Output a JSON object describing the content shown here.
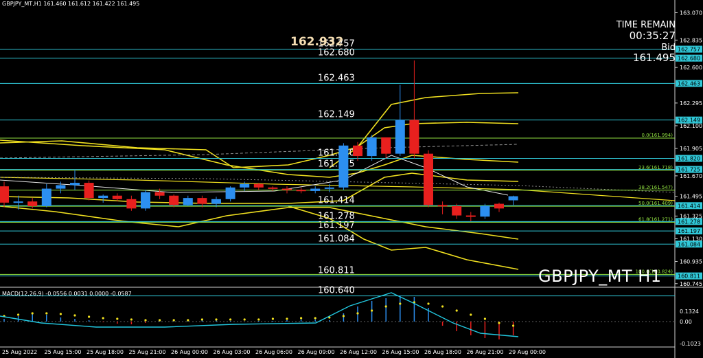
{
  "header": {
    "title": "GBPJPY_MT,H1  161.460 161.612 161.422 161.495"
  },
  "info": {
    "time_remain_label": "TIME REMAIN",
    "time_remain": "00:35:27",
    "bid_label": "Bid",
    "bid_value": "161.495"
  },
  "symbol_label": "GBPJPY_MT H1",
  "high_marker": "162.932",
  "macd": {
    "title": "MACD(12,26,9) -0.0556 0.0031 0.0000 -0.0587",
    "axis_labels": [
      "0.1324",
      "0.00",
      "-0.1023"
    ]
  },
  "price_axis": [
    "163.070",
    "162.835",
    "162.600",
    "162.295",
    "162.100",
    "161.905",
    "161.670",
    "161.495",
    "161.325",
    "161.130",
    "160.935",
    "160.745"
  ],
  "levels": [
    {
      "price": 162.757,
      "label": "162.757",
      "tag": "162.757"
    },
    {
      "price": 162.68,
      "label": "162.680",
      "tag": "162.680"
    },
    {
      "price": 162.463,
      "label": "162.463",
      "tag": "162.463"
    },
    {
      "price": 162.149,
      "label": "162.149",
      "tag": "162.149"
    },
    {
      "price": 161.82,
      "label": "161.820",
      "tag": "161.820"
    },
    {
      "price": 161.725,
      "label": "161.725",
      "tag": "161.725"
    },
    {
      "price": 161.414,
      "label": "161.414",
      "tag": "161.414"
    },
    {
      "price": 161.278,
      "label": "161.278",
      "tag": "161.278"
    },
    {
      "price": 161.197,
      "label": "161.197",
      "tag": "161.197"
    },
    {
      "price": 161.084,
      "label": "161.084",
      "tag": "161.084"
    },
    {
      "price": 160.811,
      "label": "160.811",
      "tag": "160.811"
    },
    {
      "price": 160.64,
      "label": "160.640",
      "tag": ""
    }
  ],
  "fib": [
    {
      "price": 161.994,
      "label": "0.0(161.994)"
    },
    {
      "price": 161.718,
      "label": "23.6(161.718)"
    },
    {
      "price": 161.547,
      "label": "38.2(161.547)"
    },
    {
      "price": 161.409,
      "label": "50.0(161.409)"
    },
    {
      "price": 161.271,
      "label": "61.8(161.271)"
    },
    {
      "price": 160.824,
      "label": "100.0(160.824)"
    }
  ],
  "time_axis": [
    "25 Aug 2022",
    "25 Aug 15:00",
    "25 Aug 18:00",
    "25 Aug 21:00",
    "26 Aug 00:00",
    "26 Aug 03:00",
    "26 Aug 06:00",
    "26 Aug 09:00",
    "26 Aug 12:00",
    "26 Aug 15:00",
    "26 Aug 18:00",
    "26 Aug 21:00",
    "29 Aug 00:00"
  ],
  "colors": {
    "bull": "#2c8ff0",
    "bear": "#e8201e",
    "level": "#30c8d8",
    "band": "#f0e020",
    "fib": "#90e040",
    "tag_bg": "#30c8d8"
  },
  "chart_data": {
    "type": "candlestick",
    "candles": [
      {
        "o": 161.58,
        "h": 161.62,
        "l": 161.4,
        "c": 161.44
      },
      {
        "o": 161.44,
        "h": 161.5,
        "l": 161.38,
        "c": 161.45
      },
      {
        "o": 161.45,
        "h": 161.48,
        "l": 161.39,
        "c": 161.41
      },
      {
        "o": 161.41,
        "h": 161.6,
        "l": 161.4,
        "c": 161.56
      },
      {
        "o": 161.56,
        "h": 161.62,
        "l": 161.52,
        "c": 161.59
      },
      {
        "o": 161.59,
        "h": 161.72,
        "l": 161.55,
        "c": 161.61
      },
      {
        "o": 161.61,
        "h": 161.63,
        "l": 161.46,
        "c": 161.48
      },
      {
        "o": 161.48,
        "h": 161.51,
        "l": 161.44,
        "c": 161.5
      },
      {
        "o": 161.5,
        "h": 161.52,
        "l": 161.45,
        "c": 161.47
      },
      {
        "o": 161.47,
        "h": 161.5,
        "l": 161.37,
        "c": 161.39
      },
      {
        "o": 161.39,
        "h": 161.55,
        "l": 161.37,
        "c": 161.53
      },
      {
        "o": 161.53,
        "h": 161.56,
        "l": 161.47,
        "c": 161.5
      },
      {
        "o": 161.5,
        "h": 161.51,
        "l": 161.4,
        "c": 161.42
      },
      {
        "o": 161.42,
        "h": 161.5,
        "l": 161.41,
        "c": 161.48
      },
      {
        "o": 161.48,
        "h": 161.5,
        "l": 161.4,
        "c": 161.43
      },
      {
        "o": 161.43,
        "h": 161.49,
        "l": 161.4,
        "c": 161.47
      },
      {
        "o": 161.47,
        "h": 161.58,
        "l": 161.45,
        "c": 161.57
      },
      {
        "o": 161.57,
        "h": 161.62,
        "l": 161.54,
        "c": 161.6
      },
      {
        "o": 161.6,
        "h": 161.61,
        "l": 161.55,
        "c": 161.57
      },
      {
        "o": 161.57,
        "h": 161.58,
        "l": 161.54,
        "c": 161.56
      },
      {
        "o": 161.56,
        "h": 161.58,
        "l": 161.52,
        "c": 161.55
      },
      {
        "o": 161.55,
        "h": 161.57,
        "l": 161.52,
        "c": 161.54
      },
      {
        "o": 161.54,
        "h": 161.58,
        "l": 161.52,
        "c": 161.56
      },
      {
        "o": 161.56,
        "h": 161.6,
        "l": 161.53,
        "c": 161.57
      },
      {
        "o": 161.57,
        "h": 161.95,
        "l": 161.55,
        "c": 161.93
      },
      {
        "o": 161.93,
        "h": 161.96,
        "l": 161.8,
        "c": 161.84
      },
      {
        "o": 161.84,
        "h": 162.02,
        "l": 161.8,
        "c": 162.0
      },
      {
        "o": 162.0,
        "h": 161.98,
        "l": 161.82,
        "c": 161.86
      },
      {
        "o": 161.86,
        "h": 162.45,
        "l": 161.84,
        "c": 162.15
      },
      {
        "o": 162.15,
        "h": 162.66,
        "l": 161.82,
        "c": 161.86
      },
      {
        "o": 161.86,
        "h": 161.89,
        "l": 161.4,
        "c": 161.42
      },
      {
        "o": 161.42,
        "h": 161.45,
        "l": 161.34,
        "c": 161.41
      },
      {
        "o": 161.41,
        "h": 161.43,
        "l": 161.3,
        "c": 161.33
      },
      {
        "o": 161.33,
        "h": 161.36,
        "l": 161.28,
        "c": 161.32
      },
      {
        "o": 161.32,
        "h": 161.43,
        "l": 161.3,
        "c": 161.41
      },
      {
        "o": 161.43,
        "h": 161.44,
        "l": 161.36,
        "c": 161.39
      },
      {
        "o": 161.46,
        "h": 161.5,
        "l": 161.42,
        "c": 161.495
      }
    ],
    "ylim": [
      160.72,
      163.12
    ]
  }
}
